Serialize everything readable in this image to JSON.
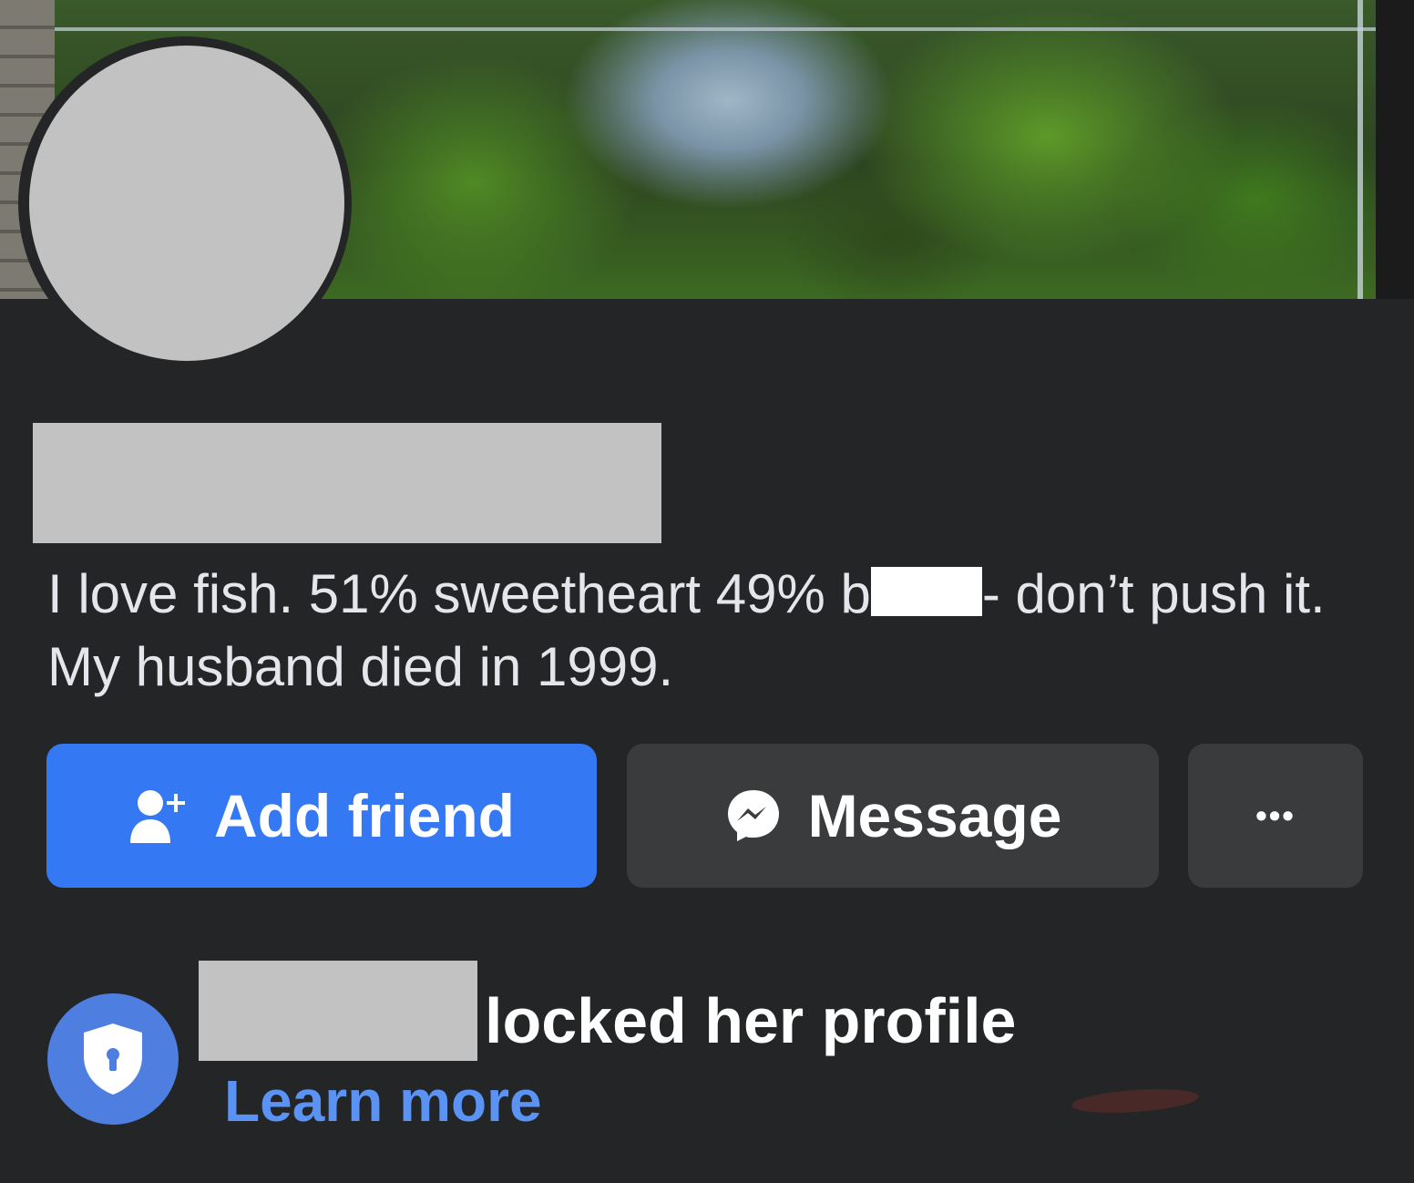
{
  "profile": {
    "bio_part1": "I love fish. 51% sweetheart 49% b",
    "bio_part2": "- don’t push it. My husband died in 1999."
  },
  "actions": {
    "add_friend_label": "Add friend",
    "message_label": "Message",
    "more_label": "•••"
  },
  "lock_notice": {
    "text": "locked her profile",
    "learn_more": "Learn more"
  },
  "colors": {
    "background": "#242526",
    "primary_button": "#3578f3",
    "secondary_button": "#3a3b3c",
    "link": "#5b93f5",
    "lock_badge": "#4e7ee0"
  },
  "icons": {
    "add_friend": "person-add-icon",
    "message": "messenger-icon",
    "more": "more-dots-icon",
    "lock": "shield-lock-icon"
  }
}
